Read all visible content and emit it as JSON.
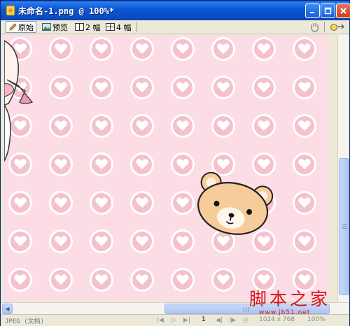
{
  "window": {
    "title": "未命名-1.png @ 100%*",
    "title_bar_color": "#0a5bd8",
    "close_button_color": "#d44a27"
  },
  "toolbar": {
    "tabs": [
      {
        "label": "原始",
        "icon": "pencil-icon",
        "active": true
      },
      {
        "label": "预览",
        "icon": "image-icon",
        "active": false
      },
      {
        "label": "2 幅",
        "icon": "two-up-icon",
        "active": false
      },
      {
        "label": "4 幅",
        "icon": "four-up-icon",
        "active": false
      }
    ],
    "right_icons": [
      "hand-tool-icon",
      "options-menu-icon"
    ]
  },
  "canvas": {
    "background_color": "#fcdde6",
    "pattern_ring_color": "#f4c1cd",
    "pattern_heart_color": "#ffffff",
    "bear_face_color": "#f6cc9a",
    "bear_muzzle_color": "#fff6ea"
  },
  "status": {
    "format": "JPEG (文档)",
    "frame": "1",
    "dimensions": "1024 x 768",
    "zoom": "100%"
  },
  "watermark": {
    "text": "脚本之家",
    "url": "www.jb51.net"
  }
}
